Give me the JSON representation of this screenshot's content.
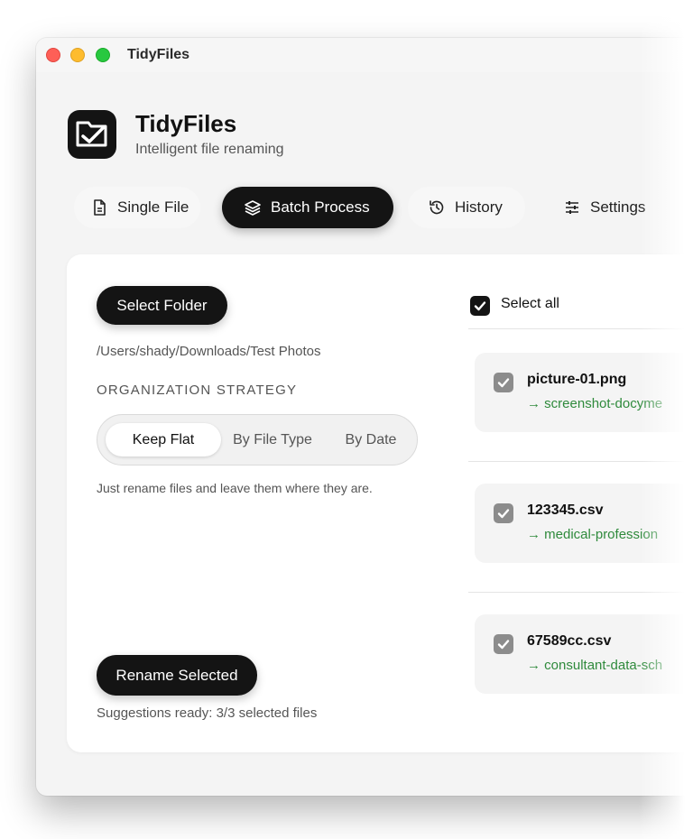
{
  "window": {
    "title": "TidyFiles"
  },
  "app": {
    "name": "TidyFiles",
    "subtitle": "Intelligent file renaming"
  },
  "tabs": [
    {
      "label": "Single File",
      "icon": "document-icon",
      "active": false
    },
    {
      "label": "Batch Process",
      "icon": "layers-icon",
      "active": true
    },
    {
      "label": "History",
      "icon": "history-icon",
      "active": false
    },
    {
      "label": "Settings",
      "icon": "sliders-icon",
      "active": false
    }
  ],
  "batch": {
    "select_folder_label": "Select Folder",
    "folder_path": "/Users/shady/Downloads/Test Photos",
    "strategy_label": "ORGANIZATION STRATEGY",
    "strategy_options": [
      "Keep Flat",
      "By File Type",
      "By Date"
    ],
    "strategy_selected": "Keep Flat",
    "strategy_description": "Just rename files and leave them where they are.",
    "rename_button_label": "Rename Selected",
    "status": "Suggestions ready: 3/3 selected files"
  },
  "files": {
    "select_all_label": "Select all",
    "select_all_checked": true,
    "items": [
      {
        "name": "picture-01.png",
        "suggestion": "→ screenshot-docyme",
        "checked": true
      },
      {
        "name": "123345.csv",
        "suggestion": "→ medical-profession",
        "checked": true
      },
      {
        "name": "67589cc.csv",
        "suggestion": "→ consultant-data-sch",
        "checked": true
      }
    ]
  },
  "colors": {
    "accent_dark": "#141414",
    "suggestion_green": "#2f8a3c",
    "light_red": "#fe5f57",
    "light_yellow": "#febc2e",
    "light_green": "#28c840"
  }
}
